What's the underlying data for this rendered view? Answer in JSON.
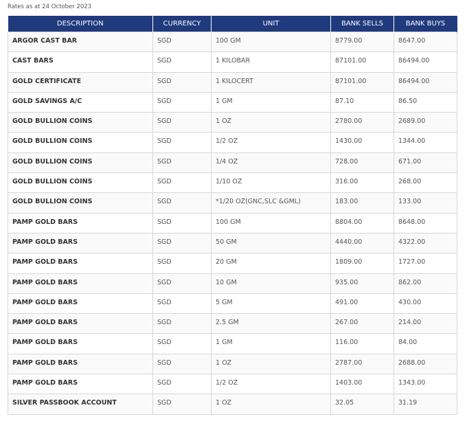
{
  "rates_date": "Rates as at 24 October 2023",
  "headers": {
    "description": "DESCRIPTION",
    "currency": "CURRENCY",
    "unit": "UNIT",
    "bank_sells": "BANK SELLS",
    "bank_buys": "BANK BUYS"
  },
  "rows": [
    {
      "description": "ARGOR CAST BAR",
      "currency": "SGD",
      "unit": "100 GM",
      "bank_sells": "8779.00",
      "bank_buys": "8647.00"
    },
    {
      "description": "CAST BARS",
      "currency": "SGD",
      "unit": "1 KILOBAR",
      "bank_sells": "87101.00",
      "bank_buys": "86494.00"
    },
    {
      "description": "GOLD CERTIFICATE",
      "currency": "SGD",
      "unit": "1 KILOCERT",
      "bank_sells": "87101.00",
      "bank_buys": "86494.00"
    },
    {
      "description": "GOLD SAVINGS A/C",
      "currency": "SGD",
      "unit": "1 GM",
      "bank_sells": "87.10",
      "bank_buys": "86.50"
    },
    {
      "description": "GOLD BULLION COINS",
      "currency": "SGD",
      "unit": "1 OZ",
      "bank_sells": "2780.00",
      "bank_buys": "2689.00"
    },
    {
      "description": "GOLD BULLION COINS",
      "currency": "SGD",
      "unit": "1/2 OZ",
      "bank_sells": "1430.00",
      "bank_buys": "1344.00"
    },
    {
      "description": "GOLD BULLION COINS",
      "currency": "SGD",
      "unit": "1/4 OZ",
      "bank_sells": "728.00",
      "bank_buys": "671.00"
    },
    {
      "description": "GOLD BULLION COINS",
      "currency": "SGD",
      "unit": "1/10 OZ",
      "bank_sells": "316.00",
      "bank_buys": "268.00"
    },
    {
      "description": "GOLD BULLION COINS",
      "currency": "SGD",
      "unit": "*1/20 OZ(GNC,SLC &GML)",
      "bank_sells": "183.00",
      "bank_buys": "133.00"
    },
    {
      "description": "PAMP GOLD BARS",
      "currency": "SGD",
      "unit": "100 GM",
      "bank_sells": "8804.00",
      "bank_buys": "8648.00"
    },
    {
      "description": "PAMP GOLD BARS",
      "currency": "SGD",
      "unit": "50 GM",
      "bank_sells": "4440.00",
      "bank_buys": "4322.00"
    },
    {
      "description": "PAMP GOLD BARS",
      "currency": "SGD",
      "unit": "20 GM",
      "bank_sells": "1809.00",
      "bank_buys": "1727.00"
    },
    {
      "description": "PAMP GOLD BARS",
      "currency": "SGD",
      "unit": "10 GM",
      "bank_sells": "935.00",
      "bank_buys": "862.00"
    },
    {
      "description": "PAMP GOLD BARS",
      "currency": "SGD",
      "unit": "5 GM",
      "bank_sells": "491.00",
      "bank_buys": "430.00"
    },
    {
      "description": "PAMP GOLD BARS",
      "currency": "SGD",
      "unit": "2.5 GM",
      "bank_sells": "267.00",
      "bank_buys": "214.00"
    },
    {
      "description": "PAMP GOLD BARS",
      "currency": "SGD",
      "unit": "1 GM",
      "bank_sells": "116.00",
      "bank_buys": "84.00"
    },
    {
      "description": "PAMP GOLD BARS",
      "currency": "SGD",
      "unit": "1 OZ",
      "bank_sells": "2787.00",
      "bank_buys": "2688.00"
    },
    {
      "description": "PAMP GOLD BARS",
      "currency": "SGD",
      "unit": "1/2 OZ",
      "bank_sells": "1403.00",
      "bank_buys": "1343.00"
    },
    {
      "description": "SILVER PASSBOOK ACCOUNT",
      "currency": "SGD",
      "unit": "1 OZ",
      "bank_sells": "32.05",
      "bank_buys": "31.19"
    }
  ],
  "colors": {
    "header_background": "#1f3a7d",
    "header_text": "#ffffff",
    "border": "#d7d7d7"
  }
}
